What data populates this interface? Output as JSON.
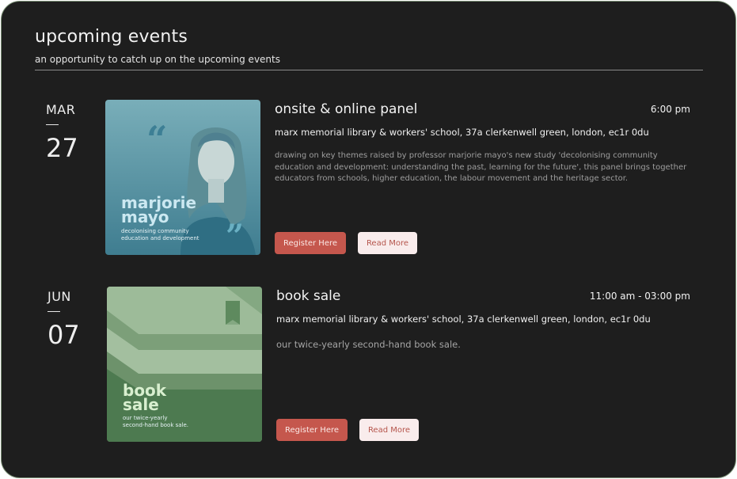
{
  "header": {
    "title": "upcoming events",
    "subtitle": "an opportunity to catch up on the upcoming events"
  },
  "events": [
    {
      "month": "MAR",
      "day": "27",
      "title": "onsite & online panel",
      "time": "6:00 pm",
      "location": "marx memorial library & workers' school, 37a clerkenwell green, london, ec1r 0du",
      "description": "drawing on key themes raised by professor marjorie mayo's new study 'decolonising community education and development: understanding the past, learning for the future', this panel brings together educators from schools, higher education, the labour movement and the heritage sector.",
      "image": {
        "heading_line1": "marjorie",
        "heading_line2": "mayo",
        "caption_line1": "decolonising community",
        "caption_line2": "education and development",
        "accent_color": "#5b97a8"
      },
      "register_label": "Register Here",
      "read_more_label": "Read More"
    },
    {
      "month": "JUN",
      "day": "07",
      "title": "book sale",
      "time": "11:00 am - 03:00 pm",
      "location": "marx memorial library & workers' school, 37a clerkenwell green, london, ec1r 0du",
      "description": "our twice-yearly second-hand book sale.",
      "image": {
        "heading_line1": "book",
        "heading_line2": "sale",
        "caption_line1": "our twice-yearly",
        "caption_line2": "second-hand book sale.",
        "accent_color": "#6f9a6c"
      },
      "register_label": "Register Here",
      "read_more_label": "Read More"
    }
  ],
  "colors": {
    "background": "#1e1e1e",
    "register_button": "#c5574d",
    "read_more_button": "#f9ecec"
  }
}
